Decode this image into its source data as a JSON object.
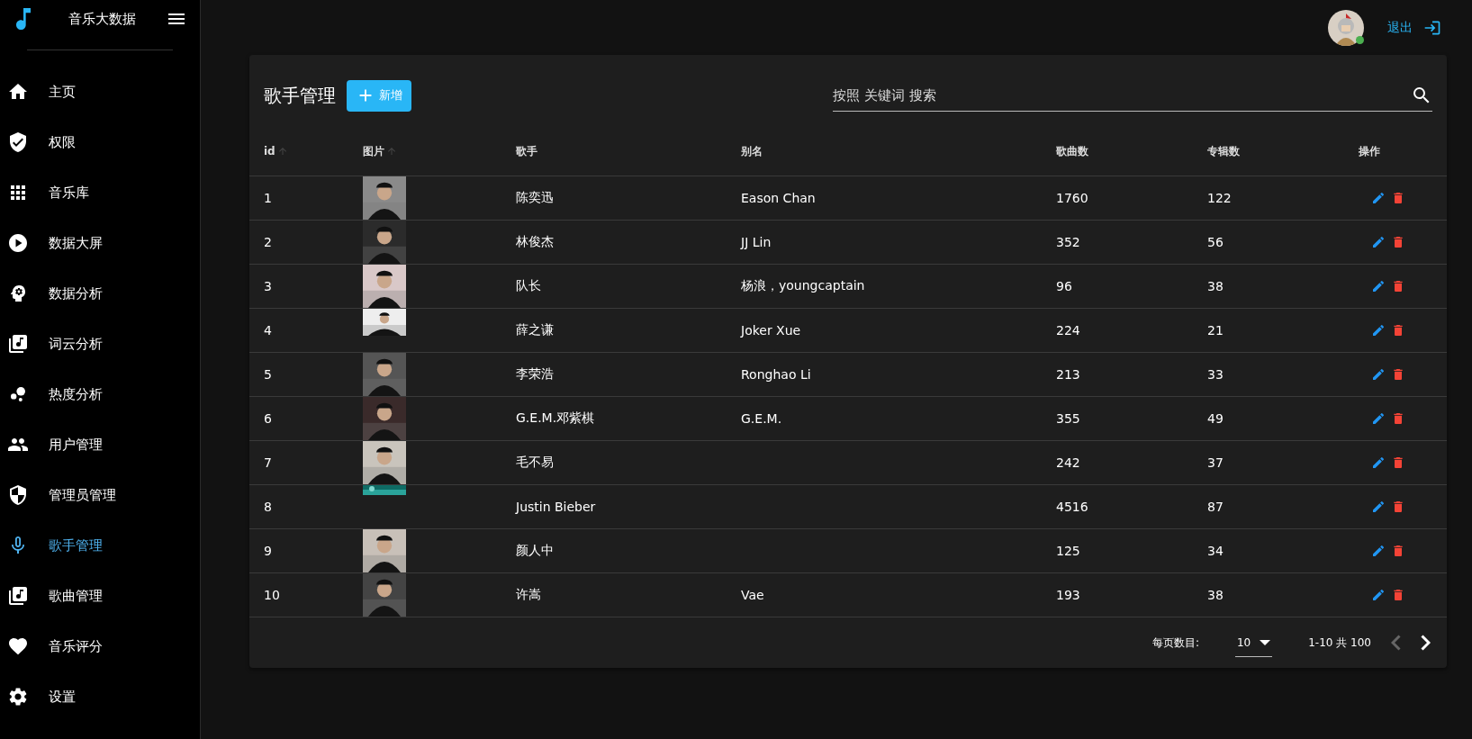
{
  "app": {
    "title": "音乐大数据"
  },
  "sidebar": {
    "items": [
      {
        "label": "主页",
        "selected": false
      },
      {
        "label": "权限",
        "selected": false
      },
      {
        "label": "音乐库",
        "selected": false
      },
      {
        "label": "数据大屏",
        "selected": false
      },
      {
        "label": "数据分析",
        "selected": false
      },
      {
        "label": "词云分析",
        "selected": false
      },
      {
        "label": "热度分析",
        "selected": false
      },
      {
        "label": "用户管理",
        "selected": false
      },
      {
        "label": "管理员管理",
        "selected": false
      },
      {
        "label": "歌手管理",
        "selected": true
      },
      {
        "label": "歌曲管理",
        "selected": false
      },
      {
        "label": "音乐评分",
        "selected": false
      },
      {
        "label": "设置",
        "selected": false
      }
    ]
  },
  "header": {
    "logout": "退出",
    "online": true
  },
  "page": {
    "title": "歌手管理",
    "add_button": "新增",
    "search": {
      "placeholder": "按照 关键词 搜索"
    }
  },
  "table": {
    "columns": [
      {
        "label": "id"
      },
      {
        "label": "图片"
      },
      {
        "label": "歌手"
      },
      {
        "label": "别名"
      },
      {
        "label": "歌曲数"
      },
      {
        "label": "专辑数"
      },
      {
        "label": "操作"
      }
    ],
    "rows": [
      {
        "id": "1",
        "singer": "陈奕迅",
        "alias": "Eason Chan",
        "songs": "1760",
        "albums": "122"
      },
      {
        "id": "2",
        "singer": "林俊杰",
        "alias": "JJ Lin",
        "songs": "352",
        "albums": "56"
      },
      {
        "id": "3",
        "singer": "队长",
        "alias": "杨浪，youngcaptain",
        "songs": "96",
        "albums": "38"
      },
      {
        "id": "4",
        "singer": "薛之谦",
        "alias": "Joker Xue",
        "songs": "224",
        "albums": "21"
      },
      {
        "id": "5",
        "singer": "李荣浩",
        "alias": "Ronghao Li",
        "songs": "213",
        "albums": "33"
      },
      {
        "id": "6",
        "singer": "G.E.M.邓紫棋",
        "alias": "G.E.M.",
        "songs": "355",
        "albums": "49"
      },
      {
        "id": "7",
        "singer": "毛不易",
        "songs": "242",
        "albums": "37"
      },
      {
        "id": "8",
        "singer": "Justin Bieber",
        "songs": "4516",
        "albums": "87"
      },
      {
        "id": "9",
        "singer": "颜人中",
        "songs": "125",
        "albums": "34"
      },
      {
        "id": "10",
        "singer": "许嵩",
        "alias": "Vae",
        "songs": "193",
        "albums": "38"
      }
    ]
  },
  "pagination": {
    "per_page_label": "每页数目:",
    "per_page": "10",
    "range": "1-10 共 100",
    "prev_disabled": true,
    "next_disabled": false
  }
}
